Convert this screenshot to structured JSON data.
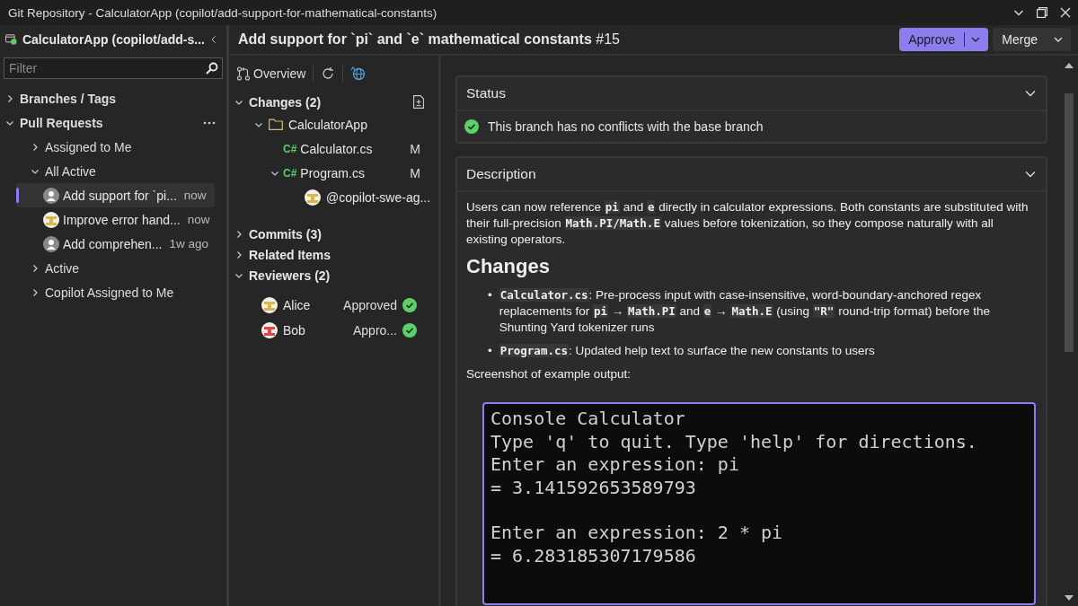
{
  "window": {
    "title": "Git Repository - CalculatorApp (copilot/add-support-for-mathematical-constants)"
  },
  "sidebar": {
    "repo": "CalculatorApp (copilot/add-s...",
    "filter": {
      "placeholder": "Filter"
    },
    "tree": [
      {
        "kind": "group",
        "label": "Branches / Tags",
        "expanded": false
      },
      {
        "kind": "group",
        "label": "Pull Requests",
        "expanded": true,
        "more_menu": true,
        "children": [
          {
            "kind": "group",
            "label": "Assigned to Me",
            "expanded": false
          },
          {
            "kind": "group",
            "label": "All Active",
            "expanded": true,
            "children": [
              {
                "kind": "pr",
                "title": "Add support for `pi...",
                "time": "now",
                "avatar": {
                  "kind": "silhouette"
                },
                "selected": true
              },
              {
                "kind": "pr",
                "title": "Improve error hand...",
                "time": "now",
                "avatar": {
                  "kind": "pattern",
                  "color": "#d9b64e"
                },
                "selected": false
              },
              {
                "kind": "pr",
                "title": "Add comprehen...",
                "time": "1w ago",
                "avatar": {
                  "kind": "silhouette"
                },
                "selected": false
              }
            ]
          },
          {
            "kind": "group",
            "label": "Active",
            "expanded": false
          },
          {
            "kind": "group",
            "label": "Copilot Assigned to Me",
            "expanded": false
          }
        ]
      }
    ]
  },
  "header": {
    "title": "Add support for `pi` and `e` mathematical constants",
    "number": "#15",
    "actions": [
      {
        "label": "Approve",
        "primary": true
      },
      {
        "label": "Merge",
        "primary": false
      }
    ]
  },
  "details": {
    "toolbar": {
      "overview": "Overview"
    },
    "sections": [
      {
        "kind": "changes",
        "label": "Changes (2)",
        "expanded": true,
        "tree": [
          {
            "kind": "folder",
            "name": "CalculatorApp",
            "expanded": true,
            "children": [
              {
                "kind": "file",
                "badge": "C#",
                "name": "Calculator.cs",
                "status": "M"
              },
              {
                "kind": "file",
                "badge": "C#",
                "name": "Program.cs",
                "status": "M",
                "expanded": true,
                "children": [
                  {
                    "kind": "comment",
                    "author": "@copilot-swe-ag...",
                    "avatar": {
                      "kind": "pattern",
                      "color": "#d9b64e"
                    }
                  }
                ]
              }
            ]
          }
        ]
      },
      {
        "kind": "plain",
        "label": "Commits (3)",
        "expanded": false
      },
      {
        "kind": "plain",
        "label": "Related Items",
        "expanded": false
      },
      {
        "kind": "reviewers",
        "label": "Reviewers (2)",
        "expanded": true,
        "reviewers": [
          {
            "name": "Alice",
            "status": "Approved",
            "approved": true,
            "avatar": {
              "kind": "pattern",
              "color": "#d9b64e"
            }
          },
          {
            "name": "Bob",
            "status": "Appro...",
            "approved": true,
            "avatar": {
              "kind": "pattern",
              "color": "#e0444f"
            }
          }
        ]
      }
    ]
  },
  "content": {
    "status": {
      "title": "Status",
      "expanded": true,
      "ok": true,
      "message": "This branch has no conflicts with the base branch"
    },
    "description": {
      "title": "Description",
      "expanded": true,
      "intro": "Users can now reference **pi** and **e** directly in calculator expressions. Both constants are substituted with their full-precision **Math.PI/Math.E** values before tokenization, so they compose naturally with all existing operators.",
      "heading": "Changes",
      "bullets": [
        {
          "marker": "•",
          "text": "**Calculator.cs**: Pre-process input with case-insensitive, word-boundary-anchored regex replacements for **pi** → **Math.PI** and **e** → **Math.E** (using **\"R\"** round-trip format) before the Shunting Yard tokenizer runs"
        },
        {
          "marker": "•",
          "text": "**Program.cs**: Updated help text to surface the new constants to users"
        }
      ],
      "caption": "Screenshot of example output:",
      "console": [
        [
          "Console Calculator",
          "Type 'q' to quit. Type 'help' for directions.",
          "Enter an expression: pi",
          "= 3.141592653589793"
        ],
        [
          "Enter an expression: 2 * pi",
          "= 6.283185307179586"
        ]
      ]
    }
  }
}
